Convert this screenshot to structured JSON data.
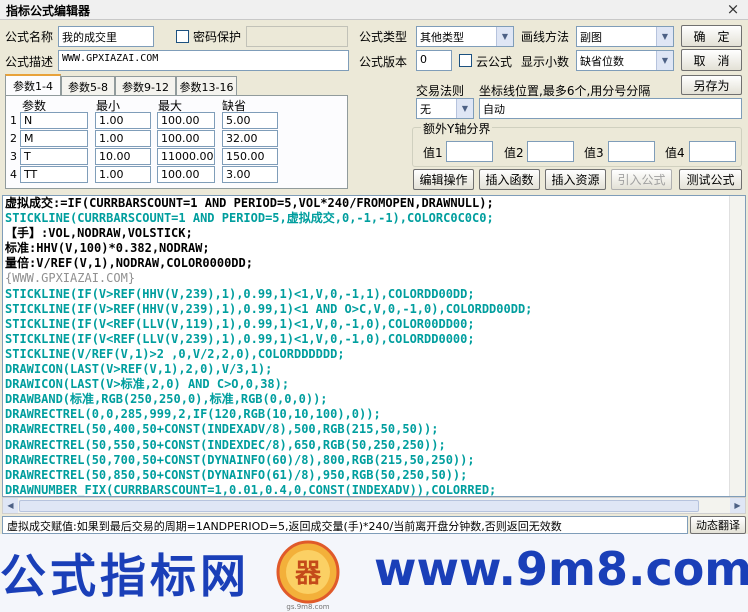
{
  "window": {
    "title": "指标公式编辑器",
    "close_glyph": "×"
  },
  "form": {
    "name_label": "公式名称",
    "name_value": "我的成交里",
    "password_label": "密码保护",
    "desc_label": "公式描述",
    "desc_value": "WWW.GPXIAZAI.COM",
    "type_label": "公式类型",
    "type_value": "其他类型",
    "version_label": "公式版本",
    "version_value": "0",
    "cloud_label": "云公式",
    "decimals_label": "显示小数",
    "decimals_value": "缺省位数",
    "draw_label": "画线方法",
    "draw_value": "副图",
    "rule_label": "交易法则",
    "rule_value": "无",
    "coord_label": "坐标线位置,最多6个,用分号分隔",
    "coord_value": "自动",
    "extra_y_label": "额外Y轴分界",
    "y_labels": [
      "值1",
      "值2",
      "值3",
      "值4"
    ]
  },
  "buttons": {
    "ok": "确　定",
    "cancel": "取　消",
    "save_as": "另存为",
    "edit_ops": "编辑操作",
    "insert_func": "插入函数",
    "insert_res": "插入资源",
    "import_formula": "引入公式",
    "test_formula": "测试公式",
    "dynamic_translate": "动态翻译"
  },
  "tabs": [
    "参数1-4",
    "参数5-8",
    "参数9-12",
    "参数13-16"
  ],
  "params": {
    "headers": [
      "参数",
      "最小",
      "最大",
      "缺省"
    ],
    "rows": [
      {
        "num": "1",
        "name": "N",
        "min": "1.00",
        "max": "100.00",
        "default": "5.00"
      },
      {
        "num": "2",
        "name": "M",
        "min": "1.00",
        "max": "100.00",
        "default": "32.00"
      },
      {
        "num": "3",
        "name": "T",
        "min": "10.00",
        "max": "11000.00",
        "default": "150.00"
      },
      {
        "num": "4",
        "name": "TT",
        "min": "1.00",
        "max": "100.00",
        "default": "3.00"
      }
    ]
  },
  "code_lines": [
    {
      "text": "虚拟成交:=IF(CURRBARSCOUNT=1 AND PERIOD=5,VOL*240/FROMOPEN,DRAWNULL);",
      "style": "mixed"
    },
    {
      "text": "STICKLINE(CURRBARSCOUNT=1 AND PERIOD=5,虚拟成交,0,-1,-1),COLORC0C0C0;",
      "style": "normal"
    },
    {
      "text": "【手】:VOL,NODRAW,VOLSTICK;",
      "style": "mixed"
    },
    {
      "text": "标准:HHV(V,100)*0.382,NODRAW;",
      "style": "mixed"
    },
    {
      "text": "量倍:V/REF(V,1),NODRAW,COLOR0000DD;",
      "style": "mixed"
    },
    {
      "text": "{WWW.GPXIAZAI.COM}",
      "style": "gray"
    },
    {
      "text": "STICKLINE(IF(V>REF(HHV(V,239),1),0.99,1)<1,V,0,-1,1),COLORDD00DD;",
      "style": "normal"
    },
    {
      "text": "STICKLINE(IF(V>REF(HHV(V,239),1),0.99,1)<1 AND O>C,V,0,-1,0),COLORDD00DD;",
      "style": "normal"
    },
    {
      "text": "STICKLINE(IF(V<REF(LLV(V,119),1),0.99,1)<1,V,0,-1,0),COLOR00DD00;",
      "style": "normal"
    },
    {
      "text": "STICKLINE(IF(V<REF(LLV(V,239),1),0.99,1)<1,V,0,-1,0),COLORDD0000;",
      "style": "normal"
    },
    {
      "text": "STICKLINE(V/REF(V,1)>2 ,0,V/2,2,0),COLORDDDDDD;",
      "style": "normal"
    },
    {
      "text": "DRAWICON(LAST(V>REF(V,1),2,0),V/3,1);",
      "style": "normal"
    },
    {
      "text": "DRAWICON(LAST(V>标准,2,0) AND C>O,0,38);",
      "style": "normal"
    },
    {
      "text": "DRAWBAND(标准,RGB(250,250,0),标准,RGB(0,0,0));",
      "style": "normal"
    },
    {
      "text": "DRAWRECTREL(0,0,285,999,2,IF(120,RGB(10,10,100),0));",
      "style": "normal"
    },
    {
      "text": "DRAWRECTREL(50,400,50+CONST(INDEXADV/8),500,RGB(215,50,50));",
      "style": "normal"
    },
    {
      "text": "DRAWRECTREL(50,550,50+CONST(INDEXDEC/8),650,RGB(50,250,250));",
      "style": "normal"
    },
    {
      "text": "DRAWRECTREL(50,700,50+CONST(DYNAINFO(60)/8),800,RGB(215,50,250));",
      "style": "normal"
    },
    {
      "text": "DRAWRECTREL(50,850,50+CONST(DYNAINFO(61)/8),950,RGB(50,250,50));",
      "style": "normal"
    },
    {
      "text": "DRAWNUMBER_FIX(CURRBARSCOUNT=1,0.01,0.4,0,CONST(INDEXADV)),COLORRED;",
      "style": "normal"
    }
  ],
  "status_text": "虚拟成交赋值:如果到最后交易的周期=1ANDPERIOD=5,返回成交量(手)*240/当前离开盘分钟数,否则返回无效数",
  "watermark": {
    "left_text": "公式指标网",
    "right_text": "www.9m8.com",
    "logo_text": "gs.9m8.com",
    "logo_mark": "器"
  },
  "colors": {
    "accent": "#e8a23a",
    "code_teal": "#009e9e",
    "watermark_blue": "#1a3fb8",
    "window_bg": "#ece9d8"
  }
}
